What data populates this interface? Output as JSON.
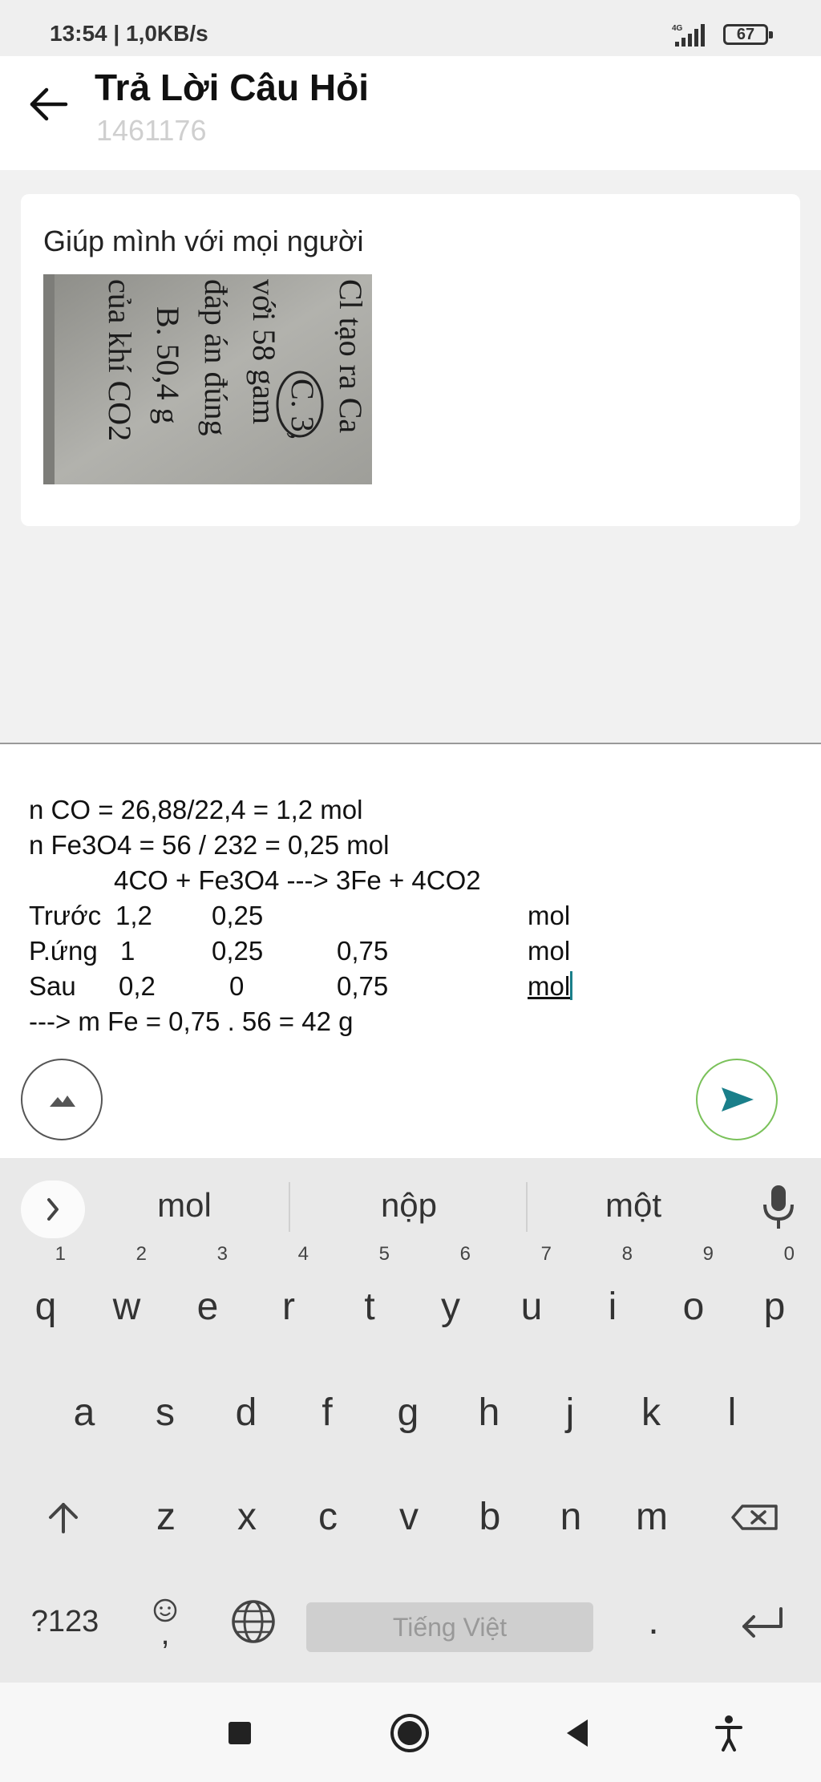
{
  "status_bar": {
    "time_and_speed": "13:54 | 1,0KB/s",
    "network": "4G",
    "battery": "67"
  },
  "header": {
    "title": "Trả Lời Câu Hỏi",
    "subtitle": "1461176",
    "back_icon": "arrow-left-icon"
  },
  "question": {
    "text": "Giúp mình với mọi người",
    "image_words": {
      "col1": "Cl tạo ra Ca",
      "col1b": "C. 3,",
      "col2": "với 58 gam",
      "col3": "đáp án đúng",
      "col4": "B. 50,4 g",
      "col5": "của khí CO2"
    }
  },
  "answer": {
    "line1": "n CO = 26,88/22,4 = 1,2 mol",
    "line2": "n Fe3O4 = 56 / 232 = 0,25 mol",
    "line3": "4CO + Fe3O4 ---> 3Fe + 4CO2",
    "row_before": {
      "label": "Trước",
      "c1": "1,2",
      "c2": "0,25",
      "unit": "mol"
    },
    "row_react": {
      "label": "P.ứng",
      "c1": "1",
      "c2": "0,25",
      "c3": "0,75",
      "unit": "mol"
    },
    "row_after": {
      "label": "Sau",
      "c1": "0,2",
      "c2": "0",
      "c3": "0,75",
      "unit": "mol"
    },
    "line_result": "---> m Fe = 0,75 . 56 = 42 g"
  },
  "composer": {
    "image_button_icon": "image-icon",
    "send_button_icon": "send-icon",
    "send_color": "#1a7f8a"
  },
  "keyboard": {
    "suggestions": [
      "mol",
      "nộp",
      "một"
    ],
    "row1": [
      {
        "key": "q",
        "hint": "1"
      },
      {
        "key": "w",
        "hint": "2"
      },
      {
        "key": "e",
        "hint": "3"
      },
      {
        "key": "r",
        "hint": "4"
      },
      {
        "key": "t",
        "hint": "5"
      },
      {
        "key": "y",
        "hint": "6"
      },
      {
        "key": "u",
        "hint": "7"
      },
      {
        "key": "i",
        "hint": "8"
      },
      {
        "key": "o",
        "hint": "9"
      },
      {
        "key": "p",
        "hint": "0"
      }
    ],
    "row2": [
      "a",
      "s",
      "d",
      "f",
      "g",
      "h",
      "j",
      "k",
      "l"
    ],
    "row3": [
      "z",
      "x",
      "c",
      "v",
      "b",
      "n",
      "m"
    ],
    "symbols_label": "?123",
    "emoji_comma": ",",
    "space_label": "Tiếng Việt",
    "period_label": "."
  },
  "nav": {
    "items": [
      "square-icon",
      "home-circle-icon",
      "back-triangle-icon",
      "accessibility-icon"
    ]
  }
}
